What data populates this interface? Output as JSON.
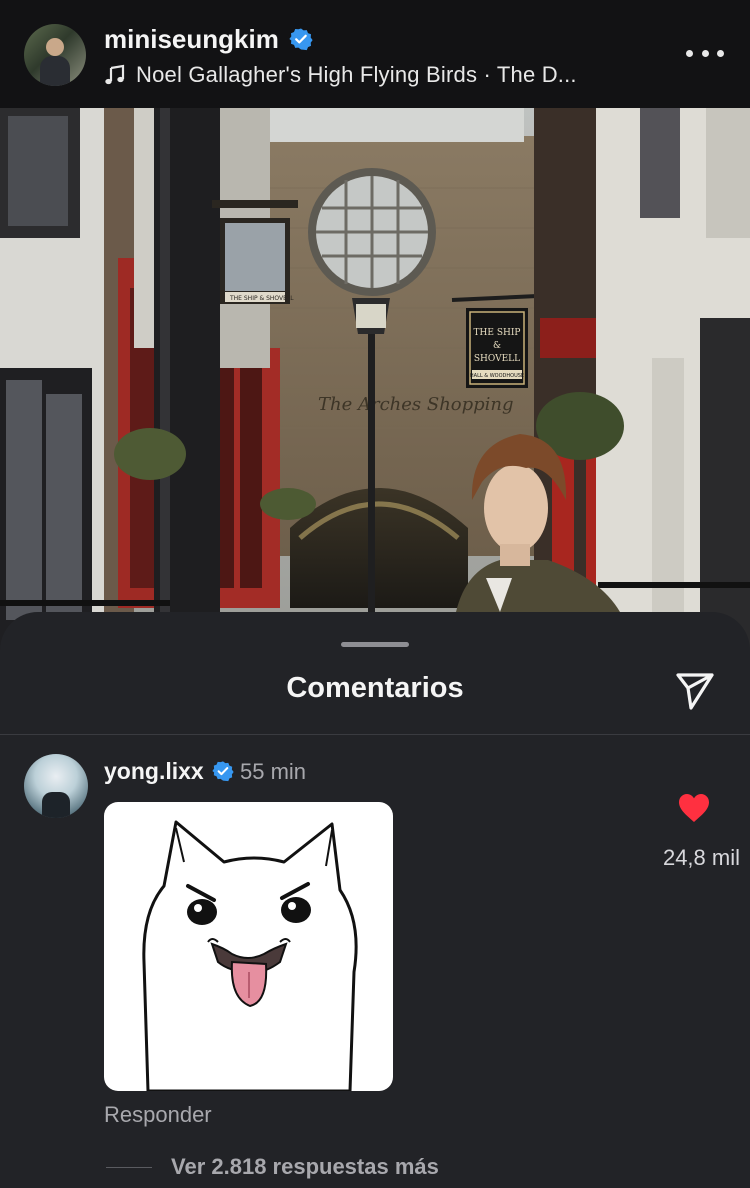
{
  "post_header": {
    "username": "miniseungkim",
    "music": "Noel Gallagher's High Flying Birds · The D...",
    "icons": {
      "verified": "verified-badge-icon",
      "music": "music-note-icon",
      "more": "more-options-icon"
    }
  },
  "photo": {
    "signs": {
      "pub_name": "THE SHIP & SHOVELL",
      "brewery": "HALL & WOODHOUSE",
      "arch_lettering": "The Arches Shopping",
      "left_sign": "THE SHIP & SHOVELL"
    }
  },
  "comments_sheet": {
    "title": "Comentarios",
    "share_icon": "send-icon",
    "comment": {
      "username": "yong.lixx",
      "time": "55 min",
      "like_count": "24,8 mil",
      "like_icon": "heart-icon",
      "liked": true,
      "reply_label": "Responder",
      "view_replies_label": "Ver 2.818 respuestas más"
    }
  },
  "colors": {
    "verified": "#3797f0",
    "heart": "#ff3040",
    "sheet": "#222327"
  }
}
